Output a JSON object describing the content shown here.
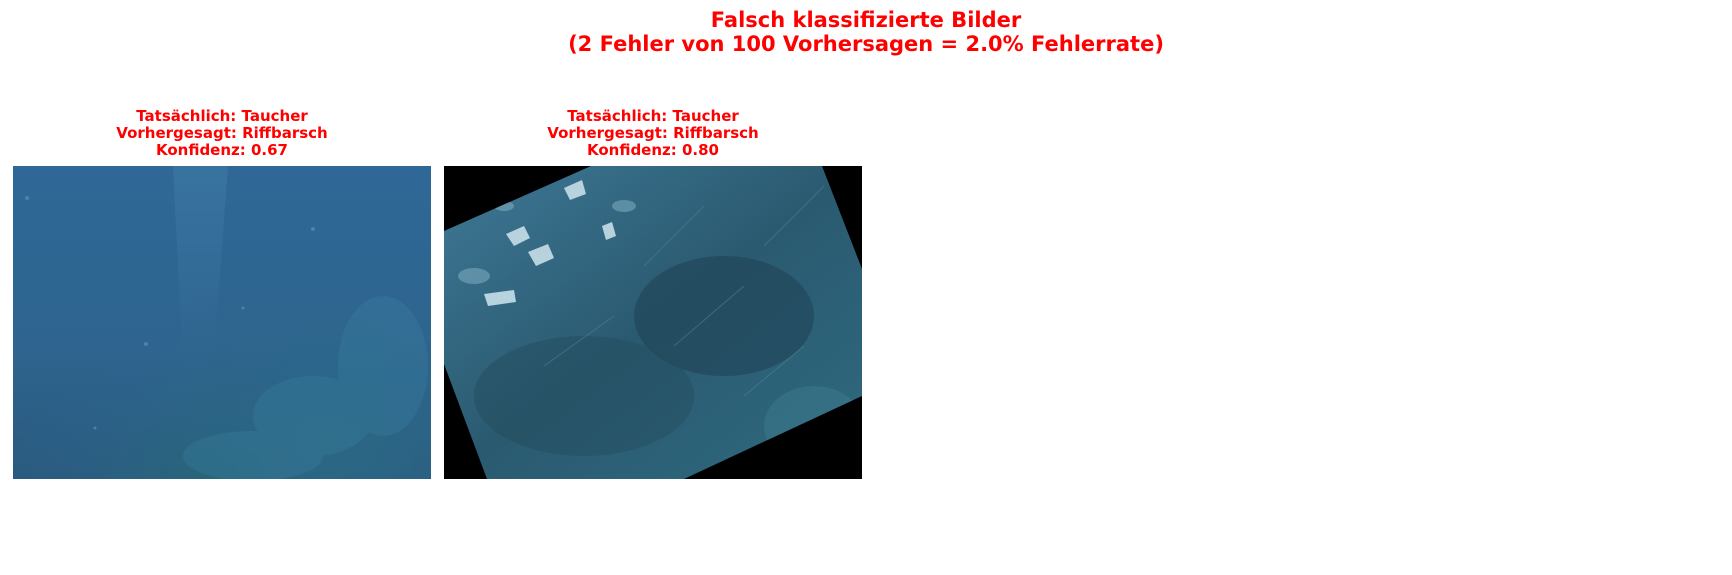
{
  "figure": {
    "title_line1": "Falsch klassifizierte Bilder",
    "title_line2": "(2 Fehler von 100 Vorhersagen = 2.0% Fehlerrate)",
    "title_color": "#ff0000"
  },
  "panels": [
    {
      "actual": "Tatsächlich: Taucher",
      "predicted": "Vorhergesagt: Riffbarsch",
      "confidence": "Konfidenz: 0.67"
    },
    {
      "actual": "Tatsächlich: Taucher",
      "predicted": "Vorhergesagt: Riffbarsch",
      "confidence": "Konfidenz: 0.80"
    }
  ]
}
